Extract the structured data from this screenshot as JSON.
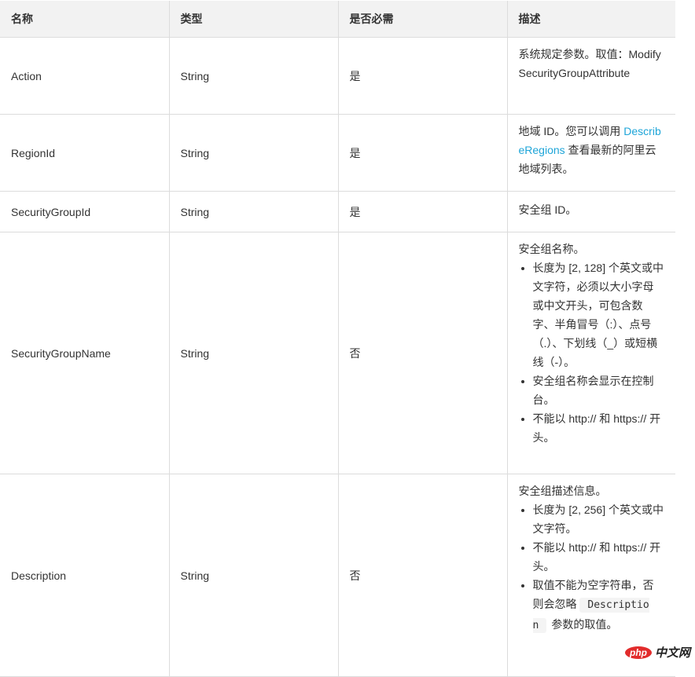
{
  "headers": [
    "名称",
    "类型",
    "是否必需",
    "描述"
  ],
  "rows": [
    {
      "name": "Action",
      "type": "String",
      "required": "是",
      "desc": {
        "text": "系统规定参数。取值：ModifySecurityGroupAttribute"
      }
    },
    {
      "name": "RegionId",
      "type": "String",
      "required": "是",
      "desc": {
        "prefix": "地域 ID。您可以调用 ",
        "link": "DescribeRegions",
        "suffix": " 查看最新的阿里云地域列表。"
      }
    },
    {
      "name": "SecurityGroupId",
      "type": "String",
      "required": "是",
      "desc": {
        "text": "安全组 ID。"
      }
    },
    {
      "name": "SecurityGroupName",
      "type": "String",
      "required": "否",
      "desc": {
        "text": "安全组名称。",
        "bullets": [
          "长度为 [2, 128] 个英文或中文字符，必须以大小字母或中文开头，可包含数字、半角冒号（:）、点号（.）、下划线（_）或短横线（-）。",
          "安全组名称会显示在控制台。",
          "不能以 http:// 和 https:// 开头。"
        ]
      }
    },
    {
      "name": "Description",
      "type": "String",
      "required": "否",
      "desc": {
        "text": "安全组描述信息。",
        "bullets": [
          "长度为 [2, 256] 个英文或中文字符。",
          "不能以 http:// 和 https:// 开头。"
        ],
        "last_bullet_prefix": "取值不能为空字符串，否则会忽略",
        "last_bullet_code": "Description",
        "last_bullet_suffix": "参数的取值。"
      }
    }
  ],
  "watermark": {
    "logo": "php",
    "text": "中文网"
  }
}
